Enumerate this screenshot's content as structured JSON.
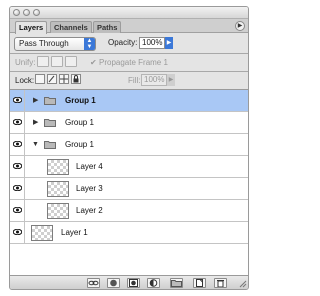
{
  "tabs": [
    {
      "label": "Layers",
      "active": true
    },
    {
      "label": "Channels",
      "active": false
    },
    {
      "label": "Paths",
      "active": false
    }
  ],
  "blend_mode": {
    "selected": "Pass Through"
  },
  "opacity": {
    "label": "Opacity:",
    "value": "100%"
  },
  "unify": {
    "label": "Unify:",
    "propagate_label": "Propagate Frame 1",
    "propagate_checked": true
  },
  "lock": {
    "label": "Lock:"
  },
  "fill": {
    "label": "Fill:",
    "value": "100%"
  },
  "layers": [
    {
      "name": "Group 1",
      "kind": "group",
      "expanded": false,
      "selected": true,
      "visible": true,
      "indent": 0
    },
    {
      "name": "Group 1",
      "kind": "group",
      "expanded": false,
      "selected": false,
      "visible": true,
      "indent": 0
    },
    {
      "name": "Group 1",
      "kind": "group",
      "expanded": true,
      "selected": false,
      "visible": true,
      "indent": 0
    },
    {
      "name": "Layer 4",
      "kind": "layer",
      "selected": false,
      "visible": true,
      "indent": 1
    },
    {
      "name": "Layer 3",
      "kind": "layer",
      "selected": false,
      "visible": true,
      "indent": 1
    },
    {
      "name": "Layer 2",
      "kind": "layer",
      "selected": false,
      "visible": true,
      "indent": 1
    },
    {
      "name": "Layer 1",
      "kind": "layer",
      "selected": false,
      "visible": true,
      "indent": 0
    }
  ],
  "colors": {
    "selection": "#a9c8f5",
    "accent": "#3b78d8"
  }
}
